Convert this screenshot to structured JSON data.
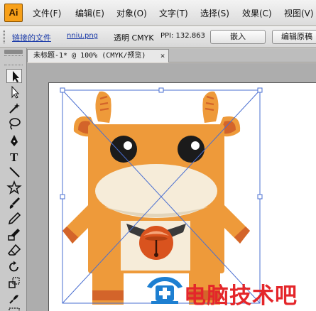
{
  "app": {
    "logo": "Ai"
  },
  "menu": {
    "items": [
      {
        "label": "文件(F)"
      },
      {
        "label": "编辑(E)"
      },
      {
        "label": "对象(O)"
      },
      {
        "label": "文字(T)"
      },
      {
        "label": "选择(S)"
      },
      {
        "label": "效果(C)"
      },
      {
        "label": "视图(V)"
      }
    ]
  },
  "control_bar": {
    "linked_file": "链接的文件",
    "file_name": "nniu.png",
    "mode": "透明 CMYK",
    "ppi": "PPI: 132.863",
    "embed_button": "嵌入",
    "edit_button": "编辑原稿"
  },
  "document": {
    "tab_title": "未标题-1* @ 100% (CMYK/预览)",
    "close_glyph": "×"
  },
  "tools": [
    {
      "icon": "selection-tool-icon"
    },
    {
      "icon": "direct-selection-tool-icon"
    },
    {
      "icon": "magic-wand-tool-icon"
    },
    {
      "icon": "lasso-tool-icon"
    },
    {
      "icon": "pen-tool-icon"
    },
    {
      "icon": "type-tool-icon"
    },
    {
      "icon": "line-tool-icon"
    },
    {
      "icon": "star-tool-icon"
    },
    {
      "icon": "paintbrush-tool-icon"
    },
    {
      "icon": "pencil-tool-icon"
    },
    {
      "icon": "blob-brush-tool-icon"
    },
    {
      "icon": "eraser-tool-icon"
    },
    {
      "icon": "rotate-tool-icon"
    },
    {
      "icon": "scale-tool-icon"
    },
    {
      "icon": "warp-tool-icon"
    },
    {
      "icon": "free-transform-tool-icon"
    }
  ],
  "watermark": {
    "text": "电脑技术吧"
  },
  "colors": {
    "cow_body": "#ee9a3a",
    "cow_dark": "#d3642a",
    "muzzle": "#f6ecd9",
    "bell": "#d9531e",
    "accent": "#f7a019",
    "watermark": "#e4262a",
    "selection": "#4a6fd1"
  }
}
